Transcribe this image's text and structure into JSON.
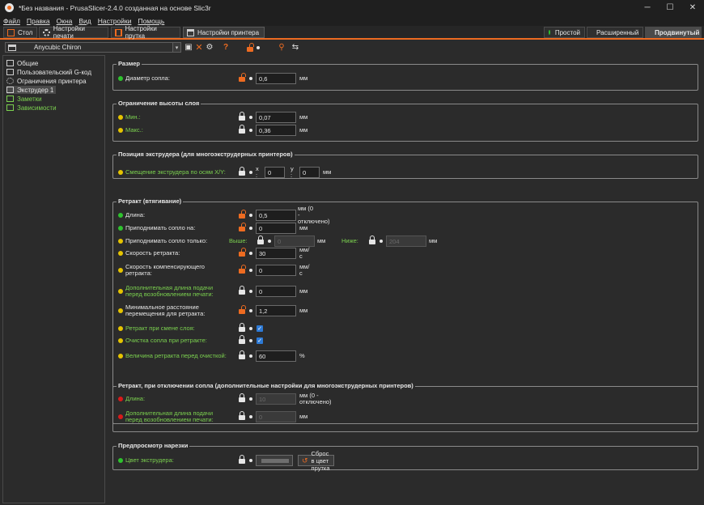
{
  "window": {
    "title": "*Без названия - PrusaSlicer-2.4.0 созданная на основе Slic3r",
    "minimize": "─",
    "maximize": "☐",
    "close": "✕"
  },
  "menu": [
    "Файл",
    "Правка",
    "Окна",
    "Вид",
    "Настройки",
    "Помощь"
  ],
  "tabs": [
    {
      "label": "Стол",
      "icon": "plater-icon"
    },
    {
      "label": "Настройки печати",
      "icon": "gear-icon"
    },
    {
      "label": "Настройки прутка",
      "icon": "spool-icon"
    },
    {
      "label": "Настройки принтера",
      "icon": "printer-icon",
      "active": true
    }
  ],
  "modes": [
    {
      "label": "Простой",
      "color": "#2ec22e"
    },
    {
      "label": "Расширенный",
      "color": "#e6c400"
    },
    {
      "label": "Продвинутый",
      "color": "#d91a1a",
      "active": true
    }
  ],
  "preset": {
    "name": "Anycubic Chiron"
  },
  "sidebar": [
    {
      "label": "Общие",
      "icon": "printer-icon"
    },
    {
      "label": "Пользовательский G-код",
      "icon": "gcode-icon"
    },
    {
      "label": "Ограничения принтера",
      "icon": "gear-icon"
    },
    {
      "label": "Экструдер 1",
      "icon": "extruder-icon",
      "selected": true
    },
    {
      "label": "Заметки",
      "icon": "notes-icon",
      "green": true
    },
    {
      "label": "Зависимости",
      "icon": "wrench-icon",
      "green": true
    }
  ],
  "colors": {
    "accent": "#ed6b21",
    "simple": "#2ec22e",
    "advanced": "#e6c400",
    "expert": "#d91a1a",
    "green_label": "#7bd14f"
  },
  "groups": {
    "size": {
      "title": "Размер",
      "nozzle": {
        "label": "Диаметр сопла:",
        "value": "0,6",
        "unit": "мм"
      }
    },
    "layer_height": {
      "title": "Ограничение высоты слоя",
      "min": {
        "label": "Мин.:",
        "value": "0,07",
        "unit": "мм"
      },
      "max": {
        "label": "Макс.:",
        "value": "0,36",
        "unit": "мм"
      }
    },
    "position": {
      "title": "Позиция экструдера (для многоэкструдерных принтеров)",
      "offset": {
        "label": "Смещение экструдера по осям X/Y:",
        "x_label": "x :",
        "x": "0",
        "y_label": "y :",
        "y": "0",
        "unit": "мм"
      }
    },
    "retraction": {
      "title": "Ретракт (втягивание)",
      "length": {
        "label": "Длина:",
        "value": "0,5",
        "unit_line1": "мм (0",
        "unit_line2": "- отключено)"
      },
      "lift": {
        "label": "Приподнимать сопло на:",
        "value": "0",
        "unit": "мм"
      },
      "lift_only": {
        "label": "Приподнимать сопло только:",
        "above_label": "Выше:",
        "above": "0",
        "above_unit": "мм",
        "below_label": "Ниже:",
        "below": "204",
        "below_unit": "мм"
      },
      "speed": {
        "label": "Скорость ретракта:",
        "value": "30",
        "unit": "мм/с"
      },
      "deretract": {
        "label_line1": "Скорость компенсирующего",
        "label_line2": "ретракта:",
        "value": "0",
        "unit": "мм/с"
      },
      "extra": {
        "label_line1": "Дополнительная длина подачи",
        "label_line2": "перед возобновлением печати:",
        "value": "0",
        "unit": "мм"
      },
      "min_travel": {
        "label_line1": "Минимальное расстояние",
        "label_line2": "перемещения для ретракта:",
        "value": "1,2",
        "unit": "мм"
      },
      "layer_change": {
        "label": "Ретракт при смене слоя:",
        "checked": true
      },
      "wipe": {
        "label": "Очистка сопла при ретракте:",
        "checked": true
      },
      "before_wipe": {
        "label": "Величина ретракта перед очисткой:",
        "value": "60",
        "unit": "%"
      }
    },
    "toolchange": {
      "title": "Ретракт, при отключении сопла (дополнительные настройки для многоэкструдерных принтеров)",
      "length": {
        "label": "Длина:",
        "value": "10",
        "unit": "мм (0 - отключено)"
      },
      "extra": {
        "label_line1": "Дополнительная длина подачи",
        "label_line2": "перед возобновлением печати:",
        "value": "0",
        "unit": "мм"
      }
    },
    "preview": {
      "title": "Предпросмотр нарезки",
      "color": {
        "label": "Цвет экструдера:",
        "reset": "Сброс в цвет прутка"
      }
    }
  }
}
